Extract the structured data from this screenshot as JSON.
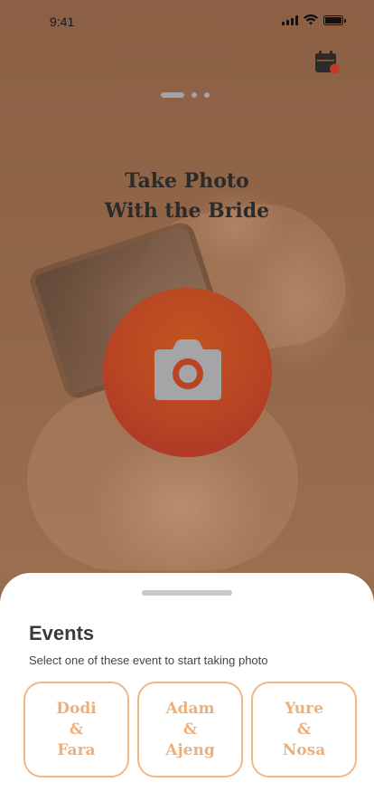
{
  "status_bar": {
    "time": "9:41",
    "icons": [
      "signal-icon",
      "wifi-icon",
      "battery-icon"
    ]
  },
  "header": {
    "calendar_icon": "calendar-icon",
    "notification_color": "#c0392b"
  },
  "pager": {
    "count": 3,
    "active_index": 0
  },
  "hero": {
    "title_line1": "Take Photo",
    "title_line2": "With the Bride",
    "camera_icon": "camera-icon",
    "accent_color": "#b84424"
  },
  "sheet": {
    "title": "Events",
    "subtitle": "Select one of these event to start taking photo",
    "events": [
      {
        "name1": "Dodi",
        "amp": "&",
        "name2": "Fara"
      },
      {
        "name1": "Adam",
        "amp": "&",
        "name2": "Ajeng"
      },
      {
        "name1": "Yure",
        "amp": "&",
        "name2": "Nosa"
      }
    ],
    "card_color": "#eeb07b"
  }
}
